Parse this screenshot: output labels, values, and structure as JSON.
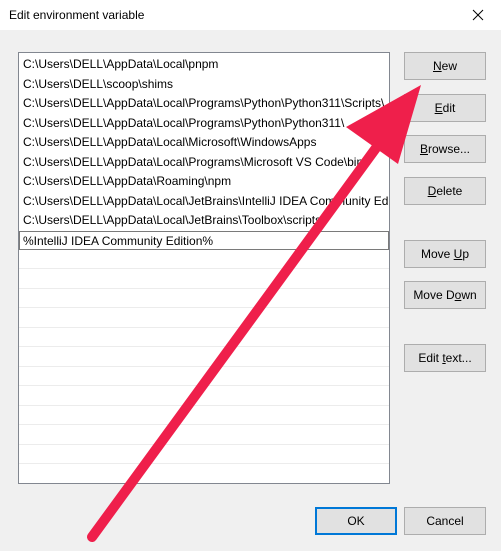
{
  "dialog": {
    "title": "Edit environment variable",
    "close_icon": "close-icon"
  },
  "list": {
    "items": [
      "C:\\Users\\DELL\\AppData\\Local\\pnpm",
      "C:\\Users\\DELL\\scoop\\shims",
      "C:\\Users\\DELL\\AppData\\Local\\Programs\\Python\\Python311\\Scripts\\",
      "C:\\Users\\DELL\\AppData\\Local\\Programs\\Python\\Python311\\",
      "C:\\Users\\DELL\\AppData\\Local\\Microsoft\\WindowsApps",
      "C:\\Users\\DELL\\AppData\\Local\\Programs\\Microsoft VS Code\\bin",
      "C:\\Users\\DELL\\AppData\\Roaming\\npm",
      "C:\\Users\\DELL\\AppData\\Local\\JetBrains\\IntelliJ IDEA Community Edi...",
      "C:\\Users\\DELL\\AppData\\Local\\JetBrains\\Toolbox\\scripts"
    ],
    "editing_value": "%IntelliJ IDEA Community Edition%"
  },
  "buttons": {
    "new": {
      "mnemonic": "N",
      "rest": "ew"
    },
    "edit": {
      "mnemonic": "E",
      "rest": "dit"
    },
    "browse": {
      "mnemonic": "B",
      "rest": "rowse..."
    },
    "delete": {
      "mnemonic": "D",
      "rest": "elete"
    },
    "move_up": {
      "before": "Move ",
      "mnemonic": "U",
      "rest": "p"
    },
    "move_down": {
      "before": "Move D",
      "mnemonic": "o",
      "rest": "wn"
    },
    "edit_text": {
      "before": "Edit ",
      "mnemonic": "t",
      "rest": "ext..."
    },
    "ok": "OK",
    "cancel": "Cancel"
  },
  "annotation": {
    "arrow_color": "#ef1f4b",
    "icon": "red-arrow-annotation"
  }
}
